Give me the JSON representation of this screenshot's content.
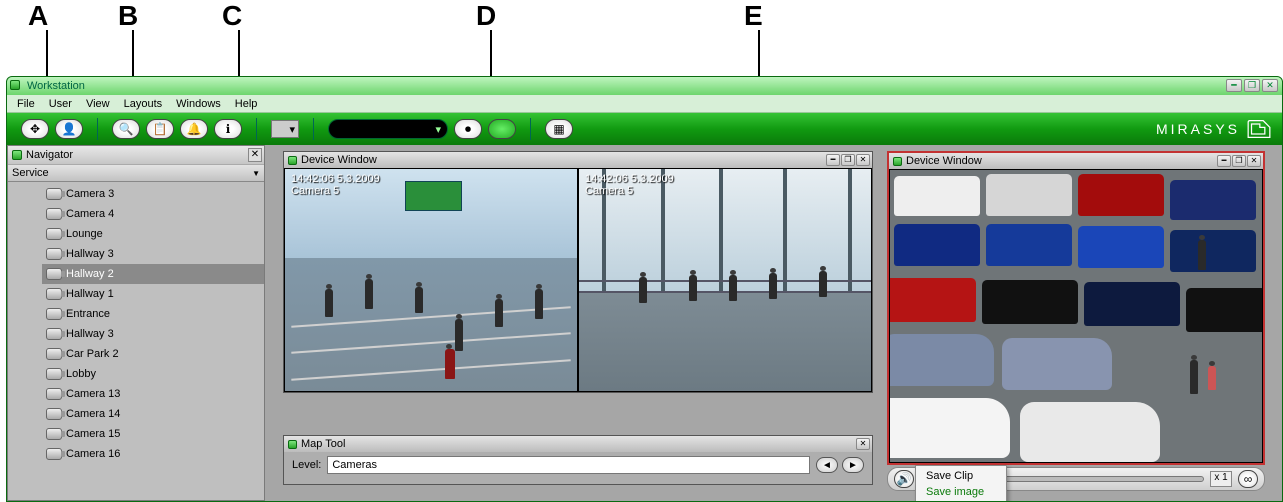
{
  "callouts": {
    "a": "A",
    "b": "B",
    "c": "C",
    "d": "D",
    "e": "E"
  },
  "app_title": "Workstation",
  "menubar": [
    "File",
    "User",
    "View",
    "Layouts",
    "Windows",
    "Help"
  ],
  "brand": "MIRASYS",
  "navigator": {
    "title": "Navigator",
    "subhead": "Service",
    "items": [
      {
        "label": "Camera 3"
      },
      {
        "label": "Camera 4"
      },
      {
        "label": "Lounge"
      },
      {
        "label": "Hallway 3"
      },
      {
        "label": "Hallway 2",
        "selected": true
      },
      {
        "label": "Hallway 1"
      },
      {
        "label": "Entrance"
      },
      {
        "label": "Hallway 3"
      },
      {
        "label": "Car Park 2"
      },
      {
        "label": "Lobby"
      },
      {
        "label": "Camera 13"
      },
      {
        "label": "Camera 14"
      },
      {
        "label": "Camera 15"
      },
      {
        "label": "Camera 16"
      }
    ]
  },
  "device_window_left": {
    "title": "Device Window",
    "feed1": {
      "timestamp": "14:42:06 5.3.2009",
      "camera": "Camera 5"
    },
    "feed2": {
      "timestamp": "14:42:06 5.3.2009",
      "camera": "Camera 5"
    }
  },
  "device_window_right": {
    "title": "Device Window",
    "speed": "x 1",
    "context_menu": [
      "Save Clip",
      "Save image"
    ]
  },
  "map_tool": {
    "title": "Map Tool",
    "level_label": "Level:",
    "level_value": "Cameras"
  }
}
